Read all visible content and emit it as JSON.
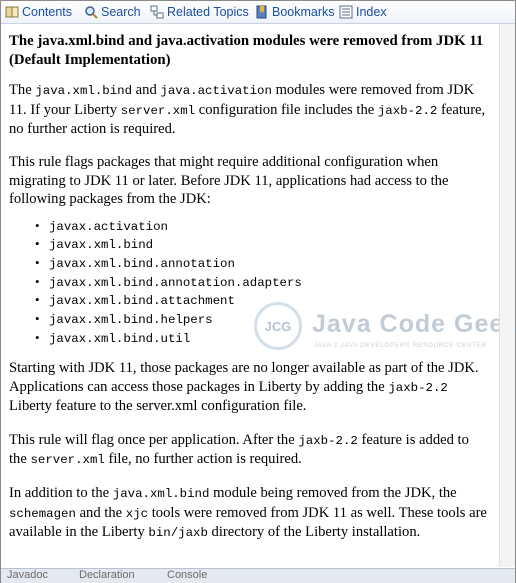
{
  "toolbar": {
    "items": [
      {
        "label": "Contents",
        "icon": "contents-icon"
      },
      {
        "label": "Search",
        "icon": "search-icon"
      },
      {
        "label": "Related Topics",
        "icon": "related-topics-icon"
      },
      {
        "label": "Bookmarks",
        "icon": "bookmarks-icon"
      },
      {
        "label": "Index",
        "icon": "index-icon"
      }
    ]
  },
  "article": {
    "title": "The java.xml.bind and java.activation modules were removed from JDK 11 (Default Implementation)",
    "p1": {
      "t1": "The ",
      "c1": "java.xml.bind",
      "t2": " and ",
      "c2": "java.activation",
      "t3": " modules were removed from JDK 11. If your Liberty ",
      "c3": "server.xml",
      "t4": " configuration file includes the ",
      "c4": "jaxb-2.2",
      "t5": " feature, no further action is required."
    },
    "p2": "This rule flags packages that might require additional configuration when migrating to JDK 11 or later. Before JDK 11, applications had access to the following packages from the JDK:",
    "packages": [
      "javax.activation",
      "javax.xml.bind",
      "javax.xml.bind.annotation",
      "javax.xml.bind.annotation.adapters",
      "javax.xml.bind.attachment",
      "javax.xml.bind.helpers",
      "javax.xml.bind.util"
    ],
    "p3": {
      "t1": "Starting with JDK 11, those packages are no longer available as part of the JDK. Applications can access those packages in Liberty by adding the ",
      "c1": "jaxb-2.2",
      "t2": " Liberty feature to the server.xml configuration file."
    },
    "p4": {
      "t1": "This rule will flag once per application. After the ",
      "c1": "jaxb-2.2",
      "t2": " feature is added to the ",
      "c2": "server.xml",
      "t3": " file, no further action is required."
    },
    "p5": {
      "t1": "In addition to the ",
      "c1": "java.xml.bind",
      "t2": " module being removed from the JDK, the ",
      "c2": "schemagen",
      "t3": " and the ",
      "c3": "xjc",
      "t4": " tools were removed from JDK 11 as well. These tools are available in the Liberty ",
      "c4": "bin/jaxb",
      "t5": " directory of the Liberty installation."
    }
  },
  "watermark": {
    "logo_text": "JCG",
    "name": "Java Code Geeks",
    "tagline": "JAVA 2 JAVA DEVELOPERS RESOURCE CENTER"
  },
  "bottom_tabs": [
    "Javadoc",
    "Declaration",
    "Console"
  ],
  "colors": {
    "link": "#1b4fa0",
    "toolbar_bg": "#eef2f8"
  }
}
